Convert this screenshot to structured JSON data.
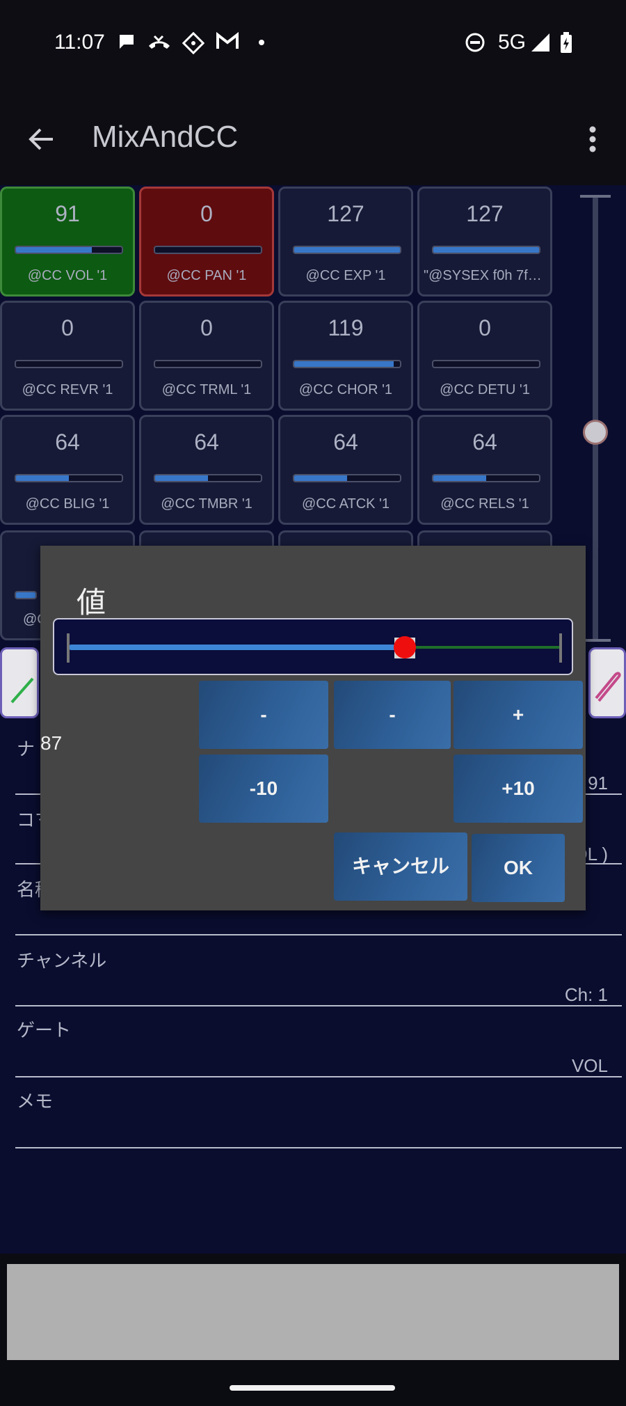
{
  "status_bar": {
    "time": "11:07",
    "network": "5G",
    "icons": [
      "chat-bubble-icon",
      "missed-call-icon",
      "app-grid-icon",
      "gmail-icon",
      "dot-icon",
      "do-not-disturb-icon",
      "signal-icon",
      "battery-charging-icon"
    ]
  },
  "app_bar": {
    "title": "MixAndCC",
    "back_icon": "arrow-back-icon",
    "menu_icon": "more-vert-icon"
  },
  "grid": {
    "cells": [
      {
        "value": "91",
        "label": "@CC VOL  '1",
        "fill": 0.72,
        "style": "green"
      },
      {
        "value": "0",
        "label": "@CC PAN  '1",
        "fill": 0.0,
        "style": "red"
      },
      {
        "value": "127",
        "label": "@CC EXP  '1",
        "fill": 1.0,
        "style": "normal"
      },
      {
        "value": "127",
        "label": "\"@SYSEX f0h 7fh ...",
        "fill": 1.0,
        "style": "normal"
      },
      {
        "value": "0",
        "label": "@CC REVR '1",
        "fill": 0.0,
        "style": "normal"
      },
      {
        "value": "0",
        "label": "@CC TRML '1",
        "fill": 0.0,
        "style": "normal"
      },
      {
        "value": "119",
        "label": "@CC CHOR '1",
        "fill": 0.94,
        "style": "normal"
      },
      {
        "value": "0",
        "label": "@CC DETU '1",
        "fill": 0.0,
        "style": "normal"
      },
      {
        "value": "64",
        "label": "@CC BLIG '1",
        "fill": 0.5,
        "style": "normal"
      },
      {
        "value": "64",
        "label": "@CC TMBR '1",
        "fill": 0.5,
        "style": "normal"
      },
      {
        "value": "64",
        "label": "@CC ATCK '1",
        "fill": 0.5,
        "style": "normal"
      },
      {
        "value": "64",
        "label": "@CC RELS '1",
        "fill": 0.5,
        "style": "normal"
      }
    ],
    "partial_row_label": "@C"
  },
  "vertical_slider": {
    "level": 0.47
  },
  "form": {
    "field1_label": "ナ",
    "field1_value": "91",
    "field2_label": "コマ",
    "field2_value": "OL )",
    "field3_label": "名稱",
    "channel_label": "チャンネル",
    "channel_value": "Ch: 1",
    "gate_label": "ゲート",
    "gate_value": "VOL",
    "memo_label": "メモ"
  },
  "dialog": {
    "title": "値",
    "value": "87",
    "slider_fraction": 0.685,
    "buttons": {
      "minus_big": "-",
      "minus_small": "-",
      "plus": "+",
      "minus10": "-10",
      "plus10": "+10",
      "cancel": "キャンセル",
      "ok": "OK"
    }
  },
  "colors": {
    "background": "#0a0d2e",
    "accent_blue": "#3877c8",
    "green_cell": "#0d5a12",
    "red_cell": "#5f0c0f",
    "slider_thumb": "#ee0e0e",
    "dialog_bg": "#454545"
  }
}
